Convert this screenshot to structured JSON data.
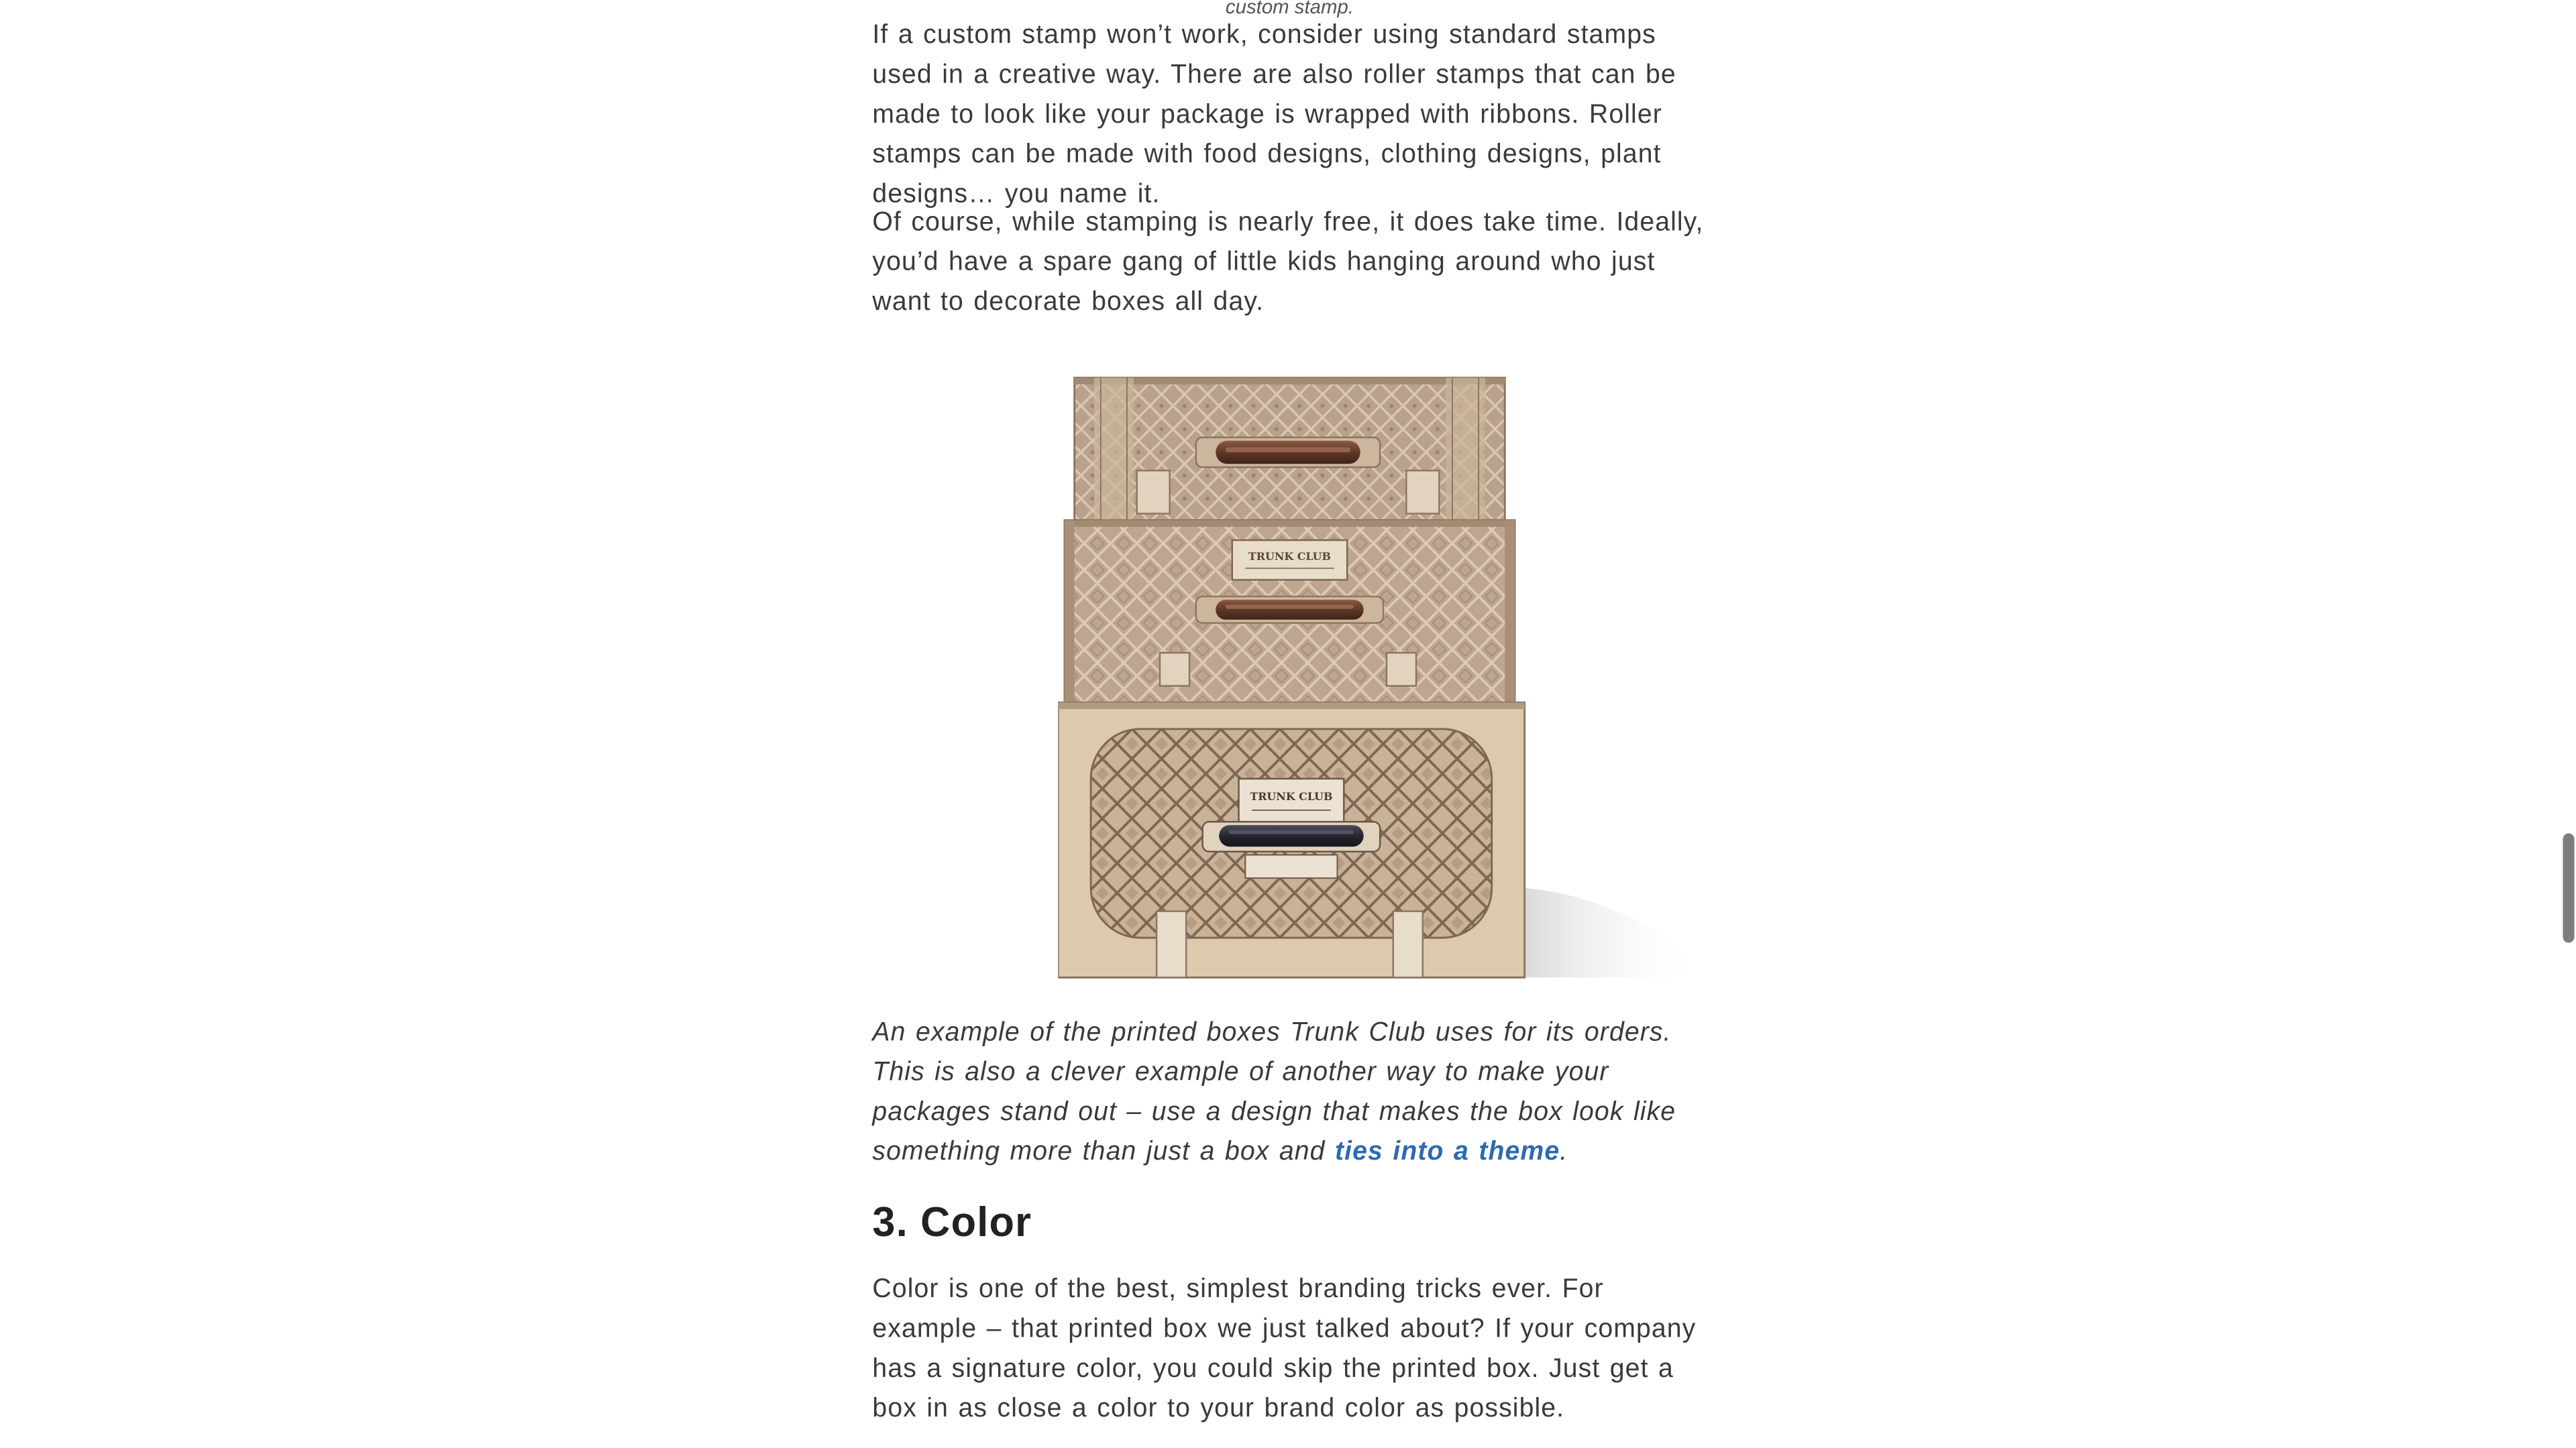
{
  "article": {
    "top_caption": "custom stamp.",
    "paragraph_1": "If a custom stamp won’t work, consider using standard stamps used in a creative way. There are also roller stamps that can be made to look like your package is wrapped with ribbons. Roller stamps can be made with food designs, clothing designs, plant designs… you name it.",
    "paragraph_2": "Of course, while stamping is nearly free, it does take time. Ideally, you’d have a spare gang of little kids hanging around who just want to decorate boxes all day.",
    "figure": {
      "label_middle": "TRUNK CLUB",
      "label_bottom": "TRUNK CLUB"
    },
    "caption_text": "An example of the printed boxes Trunk Club uses for its orders. This is also a clever example of another way to make your packages stand out – use a design that makes the box look like something more than just a box and ",
    "caption_link": "ties into a theme",
    "caption_end": ".",
    "heading": "3. Color",
    "paragraph_3": "Color is one of the best, simplest branding tricks ever. For example – that printed box we just talked about? If your company has a signature color, you could skip the printed box. Just get a box in as close a color to your brand color as possible."
  },
  "colors": {
    "body_text": "#3a3a3a",
    "link": "#2d6bb0",
    "box_dark": "#b79f89",
    "box_light": "#dcc8ae",
    "handle": "#6b4333"
  }
}
